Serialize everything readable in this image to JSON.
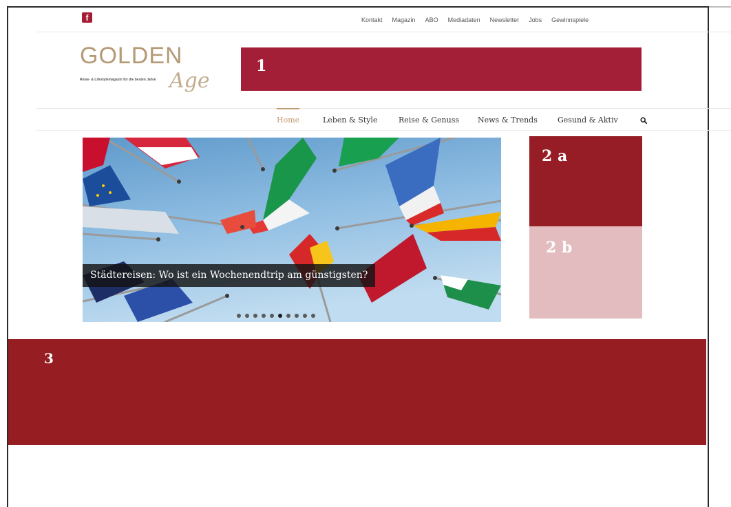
{
  "topbar": {
    "facebook_glyph": "f",
    "links": [
      "Kontakt",
      "Magazin",
      "ABO",
      "Mediadaten",
      "Newsletter",
      "Jobs",
      "Gewinnspiele"
    ]
  },
  "logo": {
    "main": "GOLDEN",
    "script": "Age",
    "tagline": "Reise- & Lifestylemagazin für die besten Jahre"
  },
  "block1": {
    "label": "1"
  },
  "mainnav": {
    "items": [
      "Home",
      "Leben & Style",
      "Reise & Genuss",
      "News & Trends",
      "Gesund & Aktiv"
    ],
    "active": "Home",
    "search_icon": "search-icon"
  },
  "hero": {
    "caption": "Städtereisen: Wo ist ein Wochenendtrip am günstigsten?",
    "slides_total": 10,
    "active_slide": 6
  },
  "block2a": {
    "label": "2 a"
  },
  "block2b": {
    "label": "2 b"
  },
  "block3": {
    "label": "3"
  },
  "colors": {
    "brand": "#a31f37",
    "dark_red": "#961d25",
    "light_pink": "#e2bcbe",
    "gold": "#c29a6e"
  }
}
